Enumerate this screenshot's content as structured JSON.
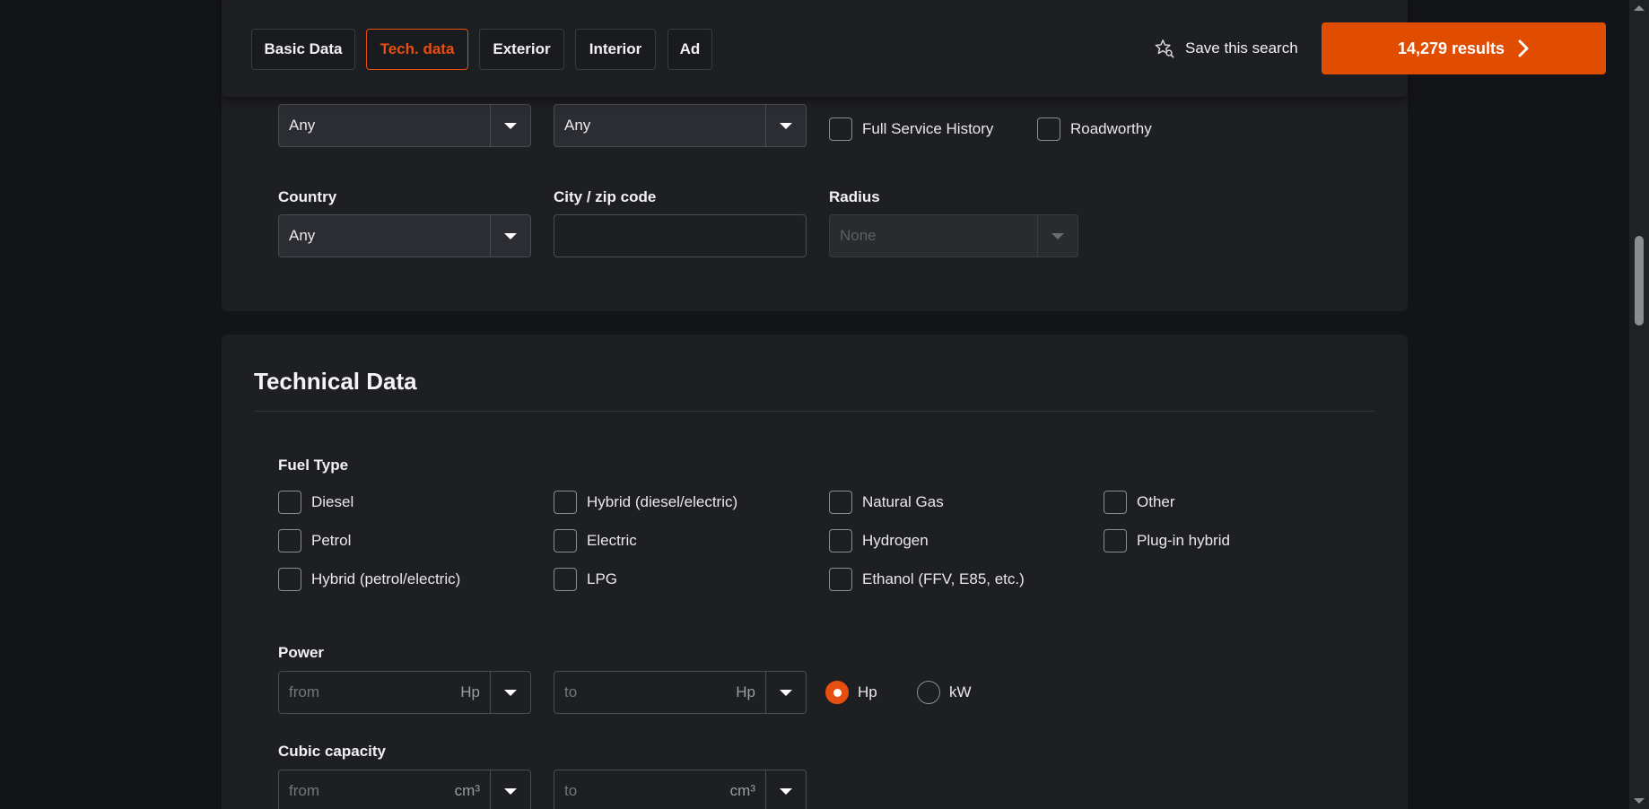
{
  "tabs": [
    {
      "label": "Basic Data",
      "active": false
    },
    {
      "label": "Tech. data",
      "active": true
    },
    {
      "label": "Exterior",
      "active": false
    },
    {
      "label": "Interior",
      "active": false
    },
    {
      "label": "Ad",
      "active": false
    }
  ],
  "header": {
    "save_label": "Save this search",
    "results_label": "14,279 results"
  },
  "top": {
    "select1_value": "Any",
    "select2_value": "Any",
    "full_service_label": "Full Service History",
    "roadworthy_label": "Roadworthy",
    "country_label": "Country",
    "country_value": "Any",
    "city_label": "City / zip code",
    "city_value": "",
    "radius_label": "Radius",
    "radius_value": "None"
  },
  "technical": {
    "title": "Technical Data",
    "fuel_label": "Fuel Type",
    "fuel_options": [
      "Diesel",
      "Hybrid (diesel/electric)",
      "Natural Gas",
      "Other",
      "Petrol",
      "Electric",
      "Hydrogen",
      "Plug-in hybrid",
      "Hybrid (petrol/electric)",
      "LPG",
      "Ethanol (FFV, E85, etc.)"
    ],
    "power_label": "Power",
    "power_from_placeholder": "from",
    "power_to_placeholder": "to",
    "power_unit": "Hp",
    "unit_hp_label": "Hp",
    "unit_kw_label": "kW",
    "selected_unit": "Hp",
    "cubic_label": "Cubic capacity",
    "cubic_from_placeholder": "from",
    "cubic_to_placeholder": "to",
    "cubic_unit": "cm³"
  },
  "colors": {
    "accent": "#e84e0f",
    "results_button": "#e14d00",
    "background": "#131418",
    "card": "#1e1f23"
  },
  "icons": {
    "save": "star-search-icon",
    "results": "chevron-right-icon",
    "dropdown": "caret-down-icon"
  }
}
